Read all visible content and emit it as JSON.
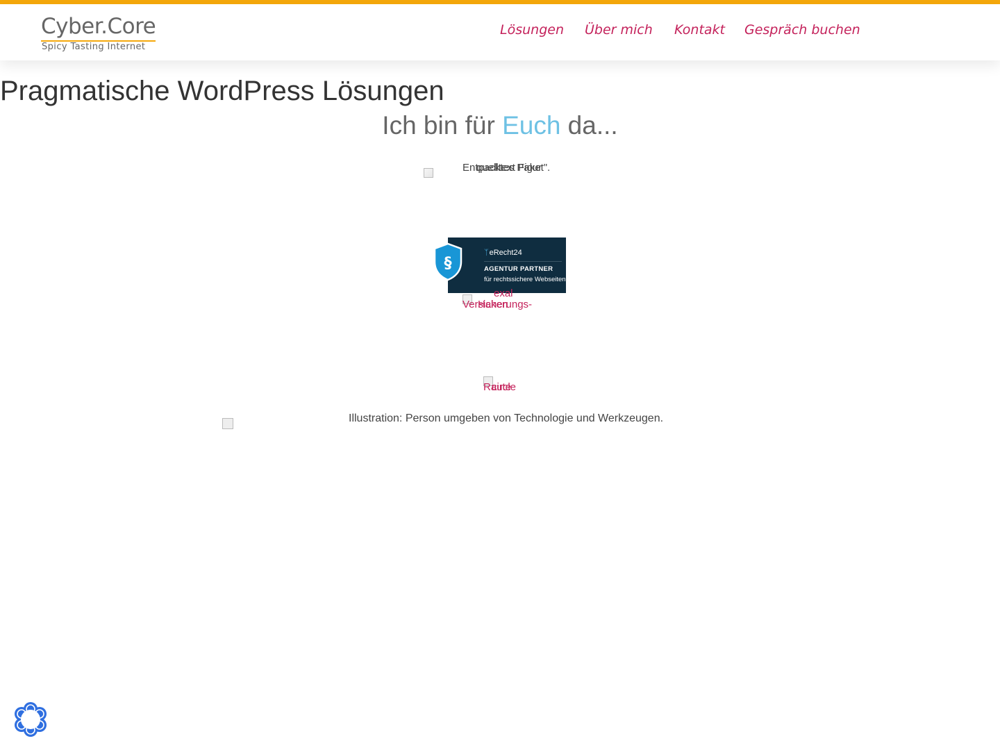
{
  "header": {
    "logo": {
      "name": "Cyber.Core",
      "tagline": "Spicy Tasting Internet"
    },
    "nav": [
      {
        "label": "Lösungen"
      },
      {
        "label": "Über mich"
      },
      {
        "label": "Kontakt"
      },
      {
        "label": "Gespräch buchen"
      }
    ]
  },
  "main": {
    "title": "Pragmatische WordPress Lösungen",
    "subtitle": {
      "prefix": "Ich bin für ",
      "accent": "Euch",
      "suffix": " da..."
    },
    "broken_images": {
      "image1_alt_a": "Entpacktes Paket\".",
      "image1_alt_b": "quelltext Figur",
      "image3_alt_a": "exal",
      "image3_alt_b": "Versicherungs-",
      "image3_alt_c": "Haken",
      "image4_alt_a": "Raute",
      "image4_alt_b": "circle",
      "image5_alt": "Illustration: Person umgeben von Technologie und Werkzeugen."
    },
    "badge": {
      "brand": "eRecht24",
      "line1": "AGENTUR PARTNER",
      "line2": "für rechtssichere Webseiten",
      "symbol": "§"
    }
  },
  "cookie_button": {
    "icon": "cookie-consent-icon"
  },
  "colors": {
    "accent_bar": "#f5a80b",
    "nav_link": "#c4225b",
    "subtitle_accent": "#6ec1e4",
    "badge_bg": "#0f2d40",
    "cookie_icon": "#2f6fe0"
  }
}
